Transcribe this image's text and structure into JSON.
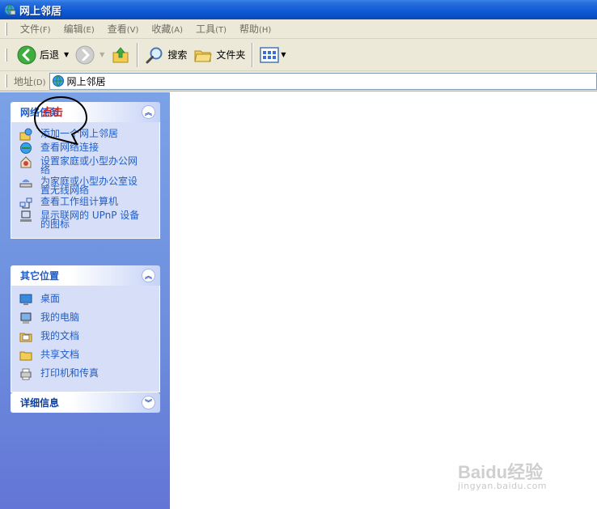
{
  "window": {
    "title": "网上邻居",
    "app_icon": "network-places-icon"
  },
  "menu": {
    "items": [
      {
        "label": "文件",
        "accel": "(F)"
      },
      {
        "label": "编辑",
        "accel": "(E)"
      },
      {
        "label": "查看",
        "accel": "(V)"
      },
      {
        "label": "收藏",
        "accel": "(A)"
      },
      {
        "label": "工具",
        "accel": "(T)"
      },
      {
        "label": "帮助",
        "accel": "(H)"
      }
    ]
  },
  "toolbar": {
    "back_label": "后退",
    "search_label": "搜索",
    "folders_label": "文件夹",
    "back_icon": "back-arrow-icon",
    "forward_icon": "forward-arrow-icon",
    "up_icon": "up-folder-icon",
    "search_icon": "search-icon",
    "folders_icon": "folders-icon",
    "views_icon": "views-icon"
  },
  "address": {
    "label": "地址",
    "accel": "(D)",
    "value": "网上邻居"
  },
  "taskpane": {
    "network_tasks": {
      "title": "网络任务",
      "items": [
        {
          "label": "添加一个网上邻居",
          "icon": "add-network-place-icon"
        },
        {
          "label": "查看网络连接",
          "icon": "network-connections-icon"
        },
        {
          "label": "设置家庭或小型办公网络",
          "icon": "home-network-setup-icon"
        },
        {
          "label": "为家庭或小型办公室设置无线网络",
          "icon": "wireless-network-setup-icon"
        },
        {
          "label": "查看工作组计算机",
          "icon": "workgroup-computers-icon"
        },
        {
          "label": "显示联网的 UPnP 设备的图标",
          "icon": "upnp-devices-icon"
        }
      ]
    },
    "other_places": {
      "title": "其它位置",
      "items": [
        {
          "label": "桌面",
          "icon": "desktop-icon"
        },
        {
          "label": "我的电脑",
          "icon": "my-computer-icon"
        },
        {
          "label": "我的文档",
          "icon": "my-documents-icon"
        },
        {
          "label": "共享文档",
          "icon": "shared-documents-icon"
        },
        {
          "label": "打印机和传真",
          "icon": "printers-faxes-icon"
        }
      ]
    },
    "details": {
      "title": "详细信息"
    }
  },
  "annotation": {
    "text": "点击"
  },
  "watermark": {
    "main": "Baidu经验",
    "sub": "jingyan.baidu.com"
  },
  "colors": {
    "titlebar": "#0a4ec4",
    "taskpane": "#6c8ddc",
    "link": "#215dc6",
    "annotation": "#d12020"
  }
}
